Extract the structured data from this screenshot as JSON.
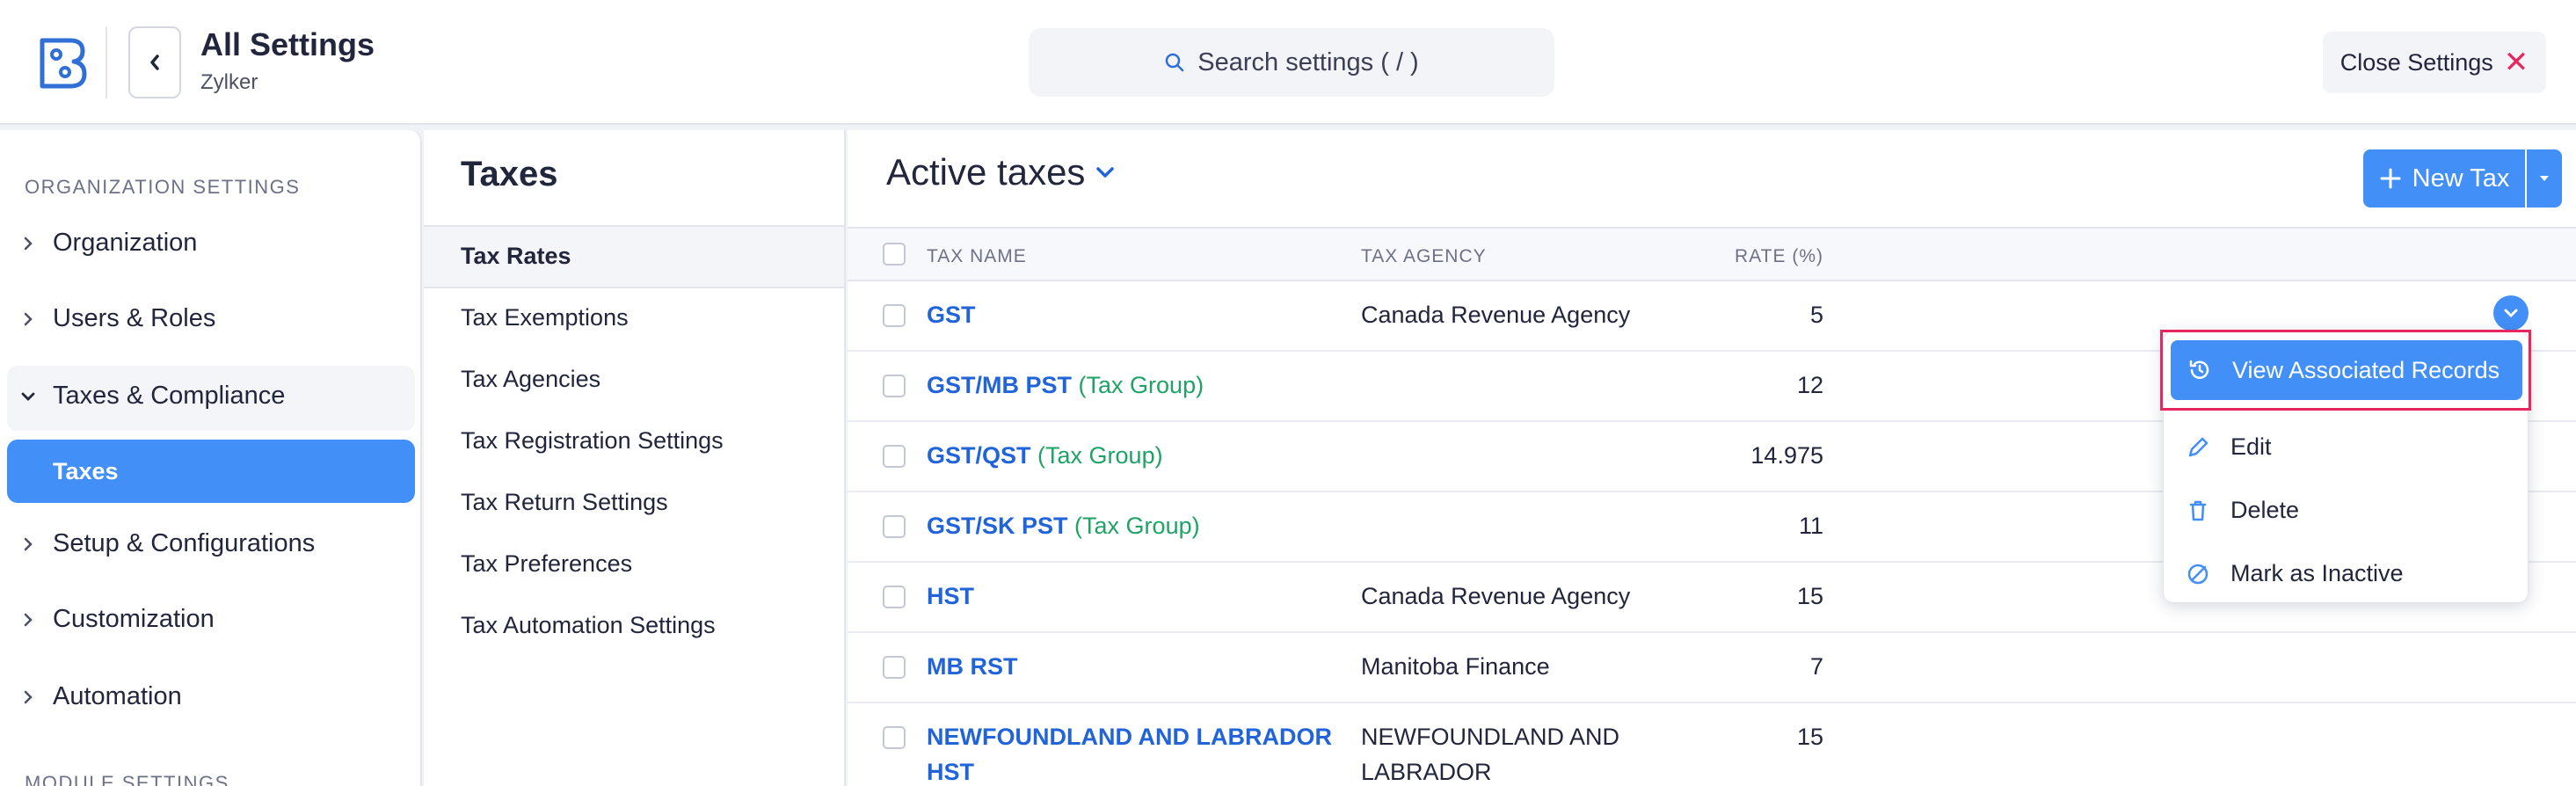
{
  "header": {
    "title": "All Settings",
    "subtitle": "Zylker",
    "search_placeholder": "Search settings ( / )",
    "close_label": "Close Settings"
  },
  "sidebar": {
    "section_org": "ORGANIZATION SETTINGS",
    "items": [
      {
        "label": "Organization"
      },
      {
        "label": "Users & Roles"
      },
      {
        "label": "Taxes & Compliance"
      },
      {
        "label": "Taxes"
      },
      {
        "label": "Setup & Configurations"
      },
      {
        "label": "Customization"
      },
      {
        "label": "Automation"
      }
    ],
    "section_module": "MODULE SETTINGS"
  },
  "subnav": {
    "title": "Taxes",
    "items": [
      {
        "label": "Tax Rates"
      },
      {
        "label": "Tax Exemptions"
      },
      {
        "label": "Tax Agencies"
      },
      {
        "label": "Tax Registration Settings"
      },
      {
        "label": "Tax Return Settings"
      },
      {
        "label": "Tax Preferences"
      },
      {
        "label": "Tax Automation Settings"
      }
    ]
  },
  "main": {
    "title": "Active taxes",
    "new_button": "New Tax",
    "columns": {
      "name": "TAX NAME",
      "agency": "TAX AGENCY",
      "rate": "RATE (%)"
    },
    "rows": [
      {
        "name": "GST",
        "group": "",
        "agency": "Canada Revenue Agency",
        "agency2": "",
        "rate": "5",
        "name2": ""
      },
      {
        "name": "GST/MB PST",
        "group": "(Tax Group)",
        "agency": "",
        "agency2": "",
        "rate": "12",
        "name2": ""
      },
      {
        "name": "GST/QST",
        "group": "(Tax Group)",
        "agency": "",
        "agency2": "",
        "rate": "14.975",
        "name2": ""
      },
      {
        "name": "GST/SK PST",
        "group": "(Tax Group)",
        "agency": "",
        "agency2": "",
        "rate": "11",
        "name2": ""
      },
      {
        "name": "HST",
        "group": "",
        "agency": "Canada Revenue Agency",
        "agency2": "",
        "rate": "15",
        "name2": ""
      },
      {
        "name": "MB RST",
        "group": "",
        "agency": "Manitoba Finance",
        "agency2": "",
        "rate": "7",
        "name2": ""
      },
      {
        "name": "NEWFOUNDLAND AND LABRADOR",
        "name2": "HST",
        "group": "",
        "agency": "NEWFOUNDLAND AND",
        "agency2": "LABRADOR",
        "rate": "15"
      }
    ]
  },
  "menu": {
    "view_associated": "View Associated Records",
    "edit": "Edit",
    "delete": "Delete",
    "mark_inactive": "Mark as Inactive"
  },
  "colors": {
    "accent": "#428ff7",
    "link": "#2164d9",
    "group": "#20a266",
    "highlight": "#e5265f"
  },
  "icons": [
    "app-logo-icon",
    "chevron-left-icon",
    "search-icon",
    "close-icon",
    "chevron-right-icon",
    "chevron-down-icon",
    "plus-icon",
    "history-icon",
    "pencil-icon",
    "trash-icon",
    "inactive-icon"
  ]
}
